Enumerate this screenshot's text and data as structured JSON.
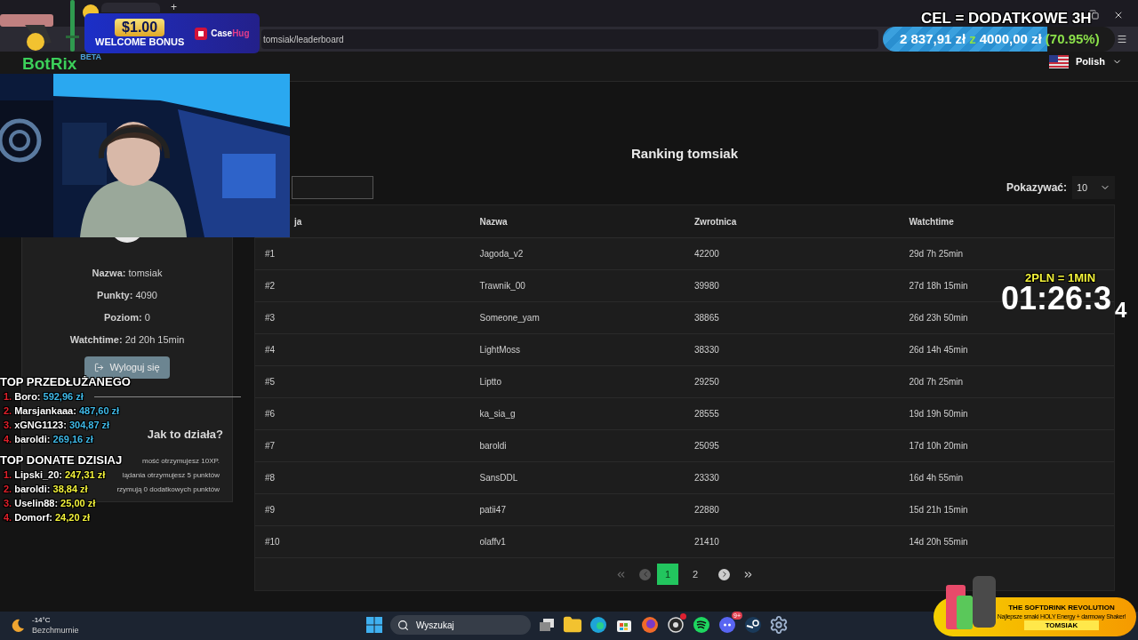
{
  "browser": {
    "address": "tomsiak/leaderboard",
    "new_tab": "+"
  },
  "navbar": {
    "beta": "BETA",
    "logo": "BotRix",
    "language": "Polish"
  },
  "profile": {
    "fields": [
      {
        "label": "Nazwa:",
        "value": "tomsiak"
      },
      {
        "label": "Punkty:",
        "value": "4090"
      },
      {
        "label": "Poziom:",
        "value": "0"
      },
      {
        "label": "Watchtime:",
        "value": "2d 20h 15min"
      }
    ],
    "logout": "Wyloguj się",
    "how_title": "Jak to działa?",
    "how_lines": [
      "mość otrzymujesz 10XP.",
      "lądania otrzymujesz 5 punktów",
      "rzymują 0 dodatkowych punktów"
    ]
  },
  "ranking": {
    "title": "Ranking tomsiak",
    "show_label": "Pokazywać:",
    "show_value": "10",
    "columns": [
      "ja",
      "Nazwa",
      "Zwrotnica",
      "Watchtime"
    ],
    "rows": [
      [
        "#1",
        "Jagoda_v2",
        "42200",
        "29d 7h 25min"
      ],
      [
        "#2",
        "Trawnik_00",
        "39980",
        "27d 18h 15min"
      ],
      [
        "#3",
        "Someone_yam",
        "38865",
        "26d 23h 50min"
      ],
      [
        "#4",
        "LightMoss",
        "38330",
        "26d 14h 45min"
      ],
      [
        "#5",
        "Liptto",
        "29250",
        "20d 7h 25min"
      ],
      [
        "#6",
        "ka_sia_g",
        "28555",
        "19d 19h 50min"
      ],
      [
        "#7",
        "baroldi",
        "25095",
        "17d 10h 20min"
      ],
      [
        "#8",
        "SansDDL",
        "23330",
        "16d 4h 55min"
      ],
      [
        "#9",
        "patii47",
        "22880",
        "15d 21h 15min"
      ],
      [
        "#10",
        "olaffv1",
        "21410",
        "14d 20h 55min"
      ]
    ]
  },
  "pagination": {
    "pages": [
      {
        "label": "1",
        "selected": true
      },
      {
        "label": "2",
        "selected": false
      }
    ]
  },
  "overlays": {
    "casehug": {
      "amount": "$1.00",
      "bonus": "WELCOME BONUS",
      "brand_a": "Case",
      "brand_b": "Hug"
    },
    "goal": {
      "title": "CEL = DODATKOWE 3H",
      "current": "2 837,91 zł",
      "z": "z",
      "target": "4000,00 zł",
      "percent": "(70.95%)",
      "level": 0.7095
    },
    "timer": {
      "rate": "2PLN = 1MIN",
      "time": "01:26:3",
      "next_digit": "4"
    },
    "lists": [
      {
        "kind": "extend",
        "title": "TOP PRZEDŁUŻANEGO",
        "entries": [
          {
            "rank": "1.",
            "name": "Boro:",
            "amount": "592,96 zł"
          },
          {
            "rank": "2.",
            "name": "Marsjankaaa:",
            "amount": "487,60 zł"
          },
          {
            "rank": "3.",
            "name": "xGNG1123:",
            "amount": "304,87 zł"
          },
          {
            "rank": "4.",
            "name": "baroldi:",
            "amount": "269,16 zł"
          }
        ]
      },
      {
        "kind": "donate",
        "title": "TOP DONATE DZISIAJ",
        "entries": [
          {
            "rank": "1.",
            "name": "Lipski_20:",
            "amount": "247,31 zł"
          },
          {
            "rank": "2.",
            "name": "baroldi:",
            "amount": "38,84 zł"
          },
          {
            "rank": "3.",
            "name": "Uselin88:",
            "amount": "25,00 zł"
          },
          {
            "rank": "4.",
            "name": "Domorf:",
            "amount": "24,20 zł"
          }
        ]
      }
    ],
    "ad": {
      "title": "THE SOFTDRINK REVOLUTION",
      "subtitle": "Najlepsze smaki HOLY Energy + darmowy Shaker!",
      "code": "TOMSIAK"
    }
  },
  "taskbar": {
    "temperature": "-14°C",
    "weather": "Bezchmurnie",
    "search": "Wyszukaj",
    "discord_badge": "9+"
  }
}
